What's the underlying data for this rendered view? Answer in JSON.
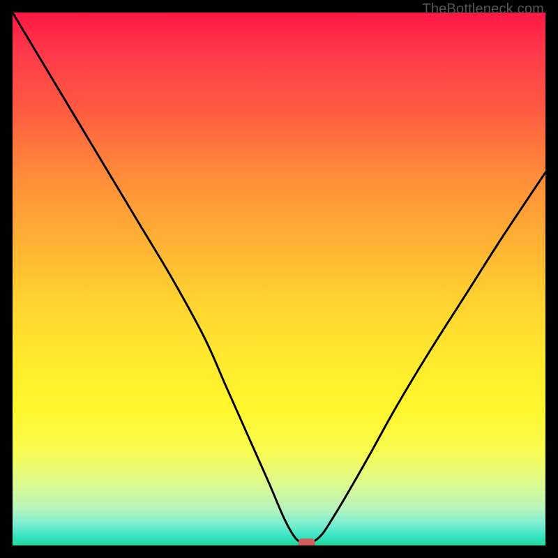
{
  "watermark": "TheBottleneck.com",
  "chart_data": {
    "type": "line",
    "title": "",
    "xlabel": "",
    "ylabel": "",
    "xlim": [
      0,
      100
    ],
    "ylim": [
      0,
      100
    ],
    "series": [
      {
        "name": "bottleneck-curve",
        "x": [
          0,
          6,
          12,
          18,
          24,
          30,
          36,
          40,
          44,
          48,
          51,
          53,
          54.5,
          56,
          58,
          60,
          63,
          67,
          72,
          78,
          85,
          92,
          100
        ],
        "values": [
          100,
          90,
          80,
          70,
          60,
          50,
          39,
          30,
          21,
          12,
          5,
          1.5,
          0.5,
          0.5,
          2,
          5,
          10,
          17,
          26,
          36,
          47,
          58,
          70
        ]
      }
    ],
    "annotations": [
      {
        "name": "optimal-marker",
        "x": 55.2,
        "y": 0.5
      }
    ]
  },
  "colors": {
    "grad_top": "#ff1744",
    "grad_bottom": "#1fd79e",
    "curve": "#000000",
    "marker": "#d06060"
  }
}
